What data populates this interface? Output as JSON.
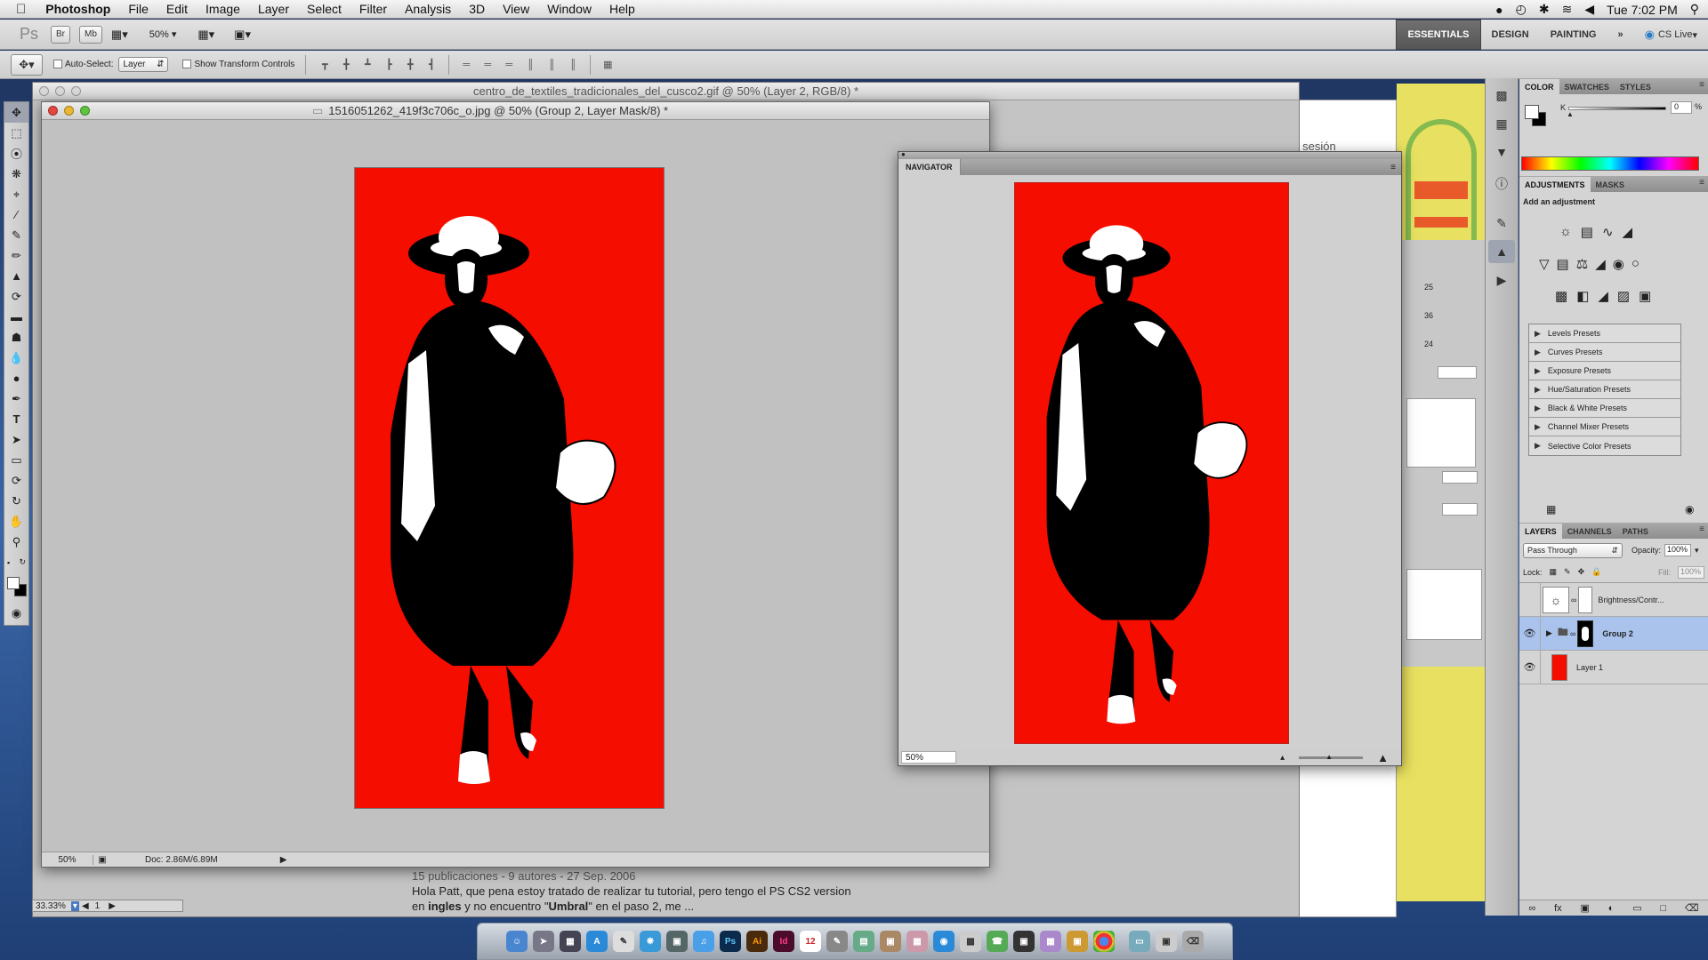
{
  "menubar": {
    "app_name": "Photoshop",
    "items": [
      "File",
      "Edit",
      "Image",
      "Layer",
      "Select",
      "Filter",
      "Analysis",
      "3D",
      "View",
      "Window",
      "Help"
    ],
    "clock": "Tue 7:02 PM"
  },
  "appbar": {
    "ps_logo": "Ps",
    "br": "Br",
    "mb": "Mb",
    "zoom": "50%",
    "workspaces": [
      "ESSENTIALS",
      "DESIGN",
      "PAINTING"
    ],
    "active_workspace": "ESSENTIALS",
    "cs_live": "CS Live"
  },
  "options": {
    "auto_select_label": "Auto-Select:",
    "auto_select_value": "Layer",
    "show_transform_label": "Show Transform Controls"
  },
  "bg_document": {
    "title": "centro_de_textiles_tradicionales_del_cusco2.gif @ 50% (Layer 2, RGB/8) *"
  },
  "fg_document": {
    "title": "1516051262_419f3c706c_o.jpg @ 50% (Group 2, Layer Mask/8) *",
    "status_zoom": "50%",
    "status_doc": "Doc: 2.86M/6.89M"
  },
  "webpage": {
    "meta": "15 publicaciones - 9 autores - 27 Sep. 2006",
    "line1": "Hola Patt, que pena estoy tratado de realizar tu tutorial, pero tengo el PS CS2 version",
    "line2_a": "en ",
    "line2_b": "ingles",
    "line2_c": " y no encuentro \"",
    "line2_d": "Umbral",
    "line2_e": "\" en el paso 2, me ...",
    "session": "ar sesión"
  },
  "bottom_zoom": "33.33%",
  "bottom_page": "1",
  "navigator": {
    "tab": "NAVIGATOR",
    "zoom": "50%"
  },
  "midpanel": {
    "nums": [
      "25",
      "36",
      "24"
    ]
  },
  "color_panel": {
    "tabs": [
      "COLOR",
      "SWATCHES",
      "STYLES"
    ],
    "k_label": "K",
    "k_value": "0",
    "k_unit": "%"
  },
  "adjustments_panel": {
    "tabs": [
      "ADJUSTMENTS",
      "MASKS"
    ],
    "heading": "Add an adjustment",
    "presets": [
      "Levels Presets",
      "Curves Presets",
      "Exposure Presets",
      "Hue/Saturation Presets",
      "Black & White Presets",
      "Channel Mixer Presets",
      "Selective Color Presets"
    ]
  },
  "layers_panel": {
    "tabs": [
      "LAYERS",
      "CHANNELS",
      "PATHS"
    ],
    "blend_mode": "Pass Through",
    "opacity_label": "Opacity:",
    "opacity": "100%",
    "lock_label": "Lock:",
    "fill_label": "Fill:",
    "fill": "100%",
    "layers": [
      {
        "name": "Brightness/Contr...",
        "visible": false,
        "selected": false
      },
      {
        "name": "Group 2",
        "visible": true,
        "selected": true
      },
      {
        "name": "Layer 1",
        "visible": true,
        "selected": false
      }
    ]
  },
  "colors": {
    "canvas_red": "#f50d00",
    "selection_blue": "#a9c3ec"
  }
}
